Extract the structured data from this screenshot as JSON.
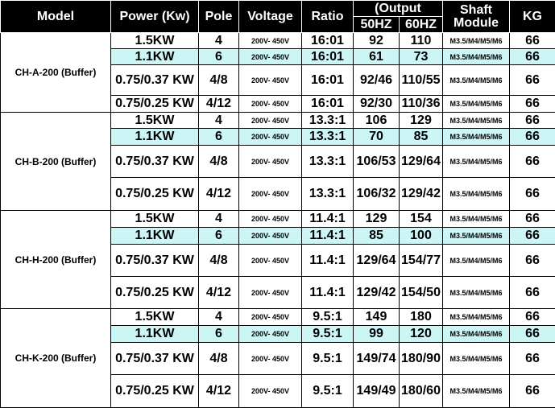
{
  "headers": {
    "model": "Model",
    "power": "Power (Kw)",
    "pole": "Pole",
    "voltage": "Voltage",
    "ratio": "Ratio",
    "output": "(Output",
    "hz50": "50HZ",
    "hz60": "60HZ",
    "shaft_line1": "Shaft",
    "shaft_line2": "Module",
    "kg": "KG"
  },
  "highlight_color": "#ccf5f5",
  "groups": [
    {
      "model": "CH-A-200 (Buffer)",
      "rows": [
        {
          "power": "1.5KW",
          "pole": "4",
          "voltage": "200V- 450V",
          "ratio": "16:01",
          "hz50": "92",
          "hz60": "110",
          "shaft": "M3.5/M4/M5/M6",
          "kg": "66"
        },
        {
          "power": "1.1KW",
          "pole": "6",
          "voltage": "200V- 450V",
          "ratio": "16:01",
          "hz50": "61",
          "hz60": "73",
          "shaft": "M3.5/M4/M5/M6",
          "kg": "66"
        },
        {
          "power": "0.75/0.37 KW",
          "pole": "4/8",
          "voltage": "200V- 450V",
          "ratio": "16:01",
          "hz50": "92/46",
          "hz60": "110/55",
          "shaft": "M3.5/M4/M5/M6",
          "kg": "66"
        },
        {
          "power": "0.75/0.25 KW",
          "pole": "4/12",
          "voltage": "200V- 450V",
          "ratio": "16:01",
          "hz50": "92/30",
          "hz60": "110/36",
          "shaft": "M3.5/M4/M5/M6",
          "kg": "66"
        }
      ]
    },
    {
      "model": "CH-B-200 (Buffer)",
      "rows": [
        {
          "power": "1.5KW",
          "pole": "4",
          "voltage": "200V- 450V",
          "ratio": "13.3:1",
          "hz50": "106",
          "hz60": "129",
          "shaft": "M3.5/M4/M5/M6",
          "kg": "66"
        },
        {
          "power": "1.1KW",
          "pole": "6",
          "voltage": "200V- 450V",
          "ratio": "13.3:1",
          "hz50": "70",
          "hz60": "85",
          "shaft": "M3.5/M4/M5/M6",
          "kg": "66"
        },
        {
          "power": "0.75/0.37 KW",
          "pole": "4/8",
          "voltage": "200V- 450V",
          "ratio": "13.3:1",
          "hz50": "106/53",
          "hz60": "129/64",
          "shaft": "M3.5/M4/M5/M6",
          "kg": "66"
        },
        {
          "power": "0.75/0.25 KW",
          "pole": "4/12",
          "voltage": "200V- 450V",
          "ratio": "13.3:1",
          "hz50": "106/32",
          "hz60": "129/42",
          "shaft": "M3.5/M4/M5/M6",
          "kg": "66"
        }
      ]
    },
    {
      "model": "CH-H-200 (Buffer)",
      "rows": [
        {
          "power": "1.5KW",
          "pole": "4",
          "voltage": "200V- 450V",
          "ratio": "11.4:1",
          "hz50": "129",
          "hz60": "154",
          "shaft": "M3.5/M4/M5/M6",
          "kg": "66"
        },
        {
          "power": "1.1KW",
          "pole": "6",
          "voltage": "200V- 450V",
          "ratio": "11.4:1",
          "hz50": "85",
          "hz60": "100",
          "shaft": "M3.5/M4/M5/M6",
          "kg": "66"
        },
        {
          "power": "0.75/0.37 KW",
          "pole": "4/8",
          "voltage": "200V- 450V",
          "ratio": "11.4:1",
          "hz50": "129/64",
          "hz60": "154/77",
          "shaft": "M3.5/M4/M5/M6",
          "kg": "66"
        },
        {
          "power": "0.75/0.25 KW",
          "pole": "4/12",
          "voltage": "200V- 450V",
          "ratio": "11.4:1",
          "hz50": "129/42",
          "hz60": "154/50",
          "shaft": "M3.5/M4/M5/M6",
          "kg": "66"
        }
      ]
    },
    {
      "model": "CH-K-200 (Buffer)",
      "rows": [
        {
          "power": "1.5KW",
          "pole": "4",
          "voltage": "200V- 450V",
          "ratio": "9.5:1",
          "hz50": "149",
          "hz60": "180",
          "shaft": "M3.5/M4/M5/M6",
          "kg": "66"
        },
        {
          "power": "1.1KW",
          "pole": "6",
          "voltage": "200V- 450V",
          "ratio": "9.5:1",
          "hz50": "99",
          "hz60": "120",
          "shaft": "M3.5/M4/M5/M6",
          "kg": "66"
        },
        {
          "power": "0.75/0.37 KW",
          "pole": "4/8",
          "voltage": "200V- 450V",
          "ratio": "9.5:1",
          "hz50": "149/74",
          "hz60": "180/90",
          "shaft": "M3.5/M4/M5/M6",
          "kg": "66"
        },
        {
          "power": "0.75/0.25 KW",
          "pole": "4/12",
          "voltage": "200V- 450V",
          "ratio": "9.5:1",
          "hz50": "149/49",
          "hz60": "180/60",
          "shaft": "M3.5/M4/M5/M6",
          "kg": "66"
        }
      ]
    }
  ]
}
